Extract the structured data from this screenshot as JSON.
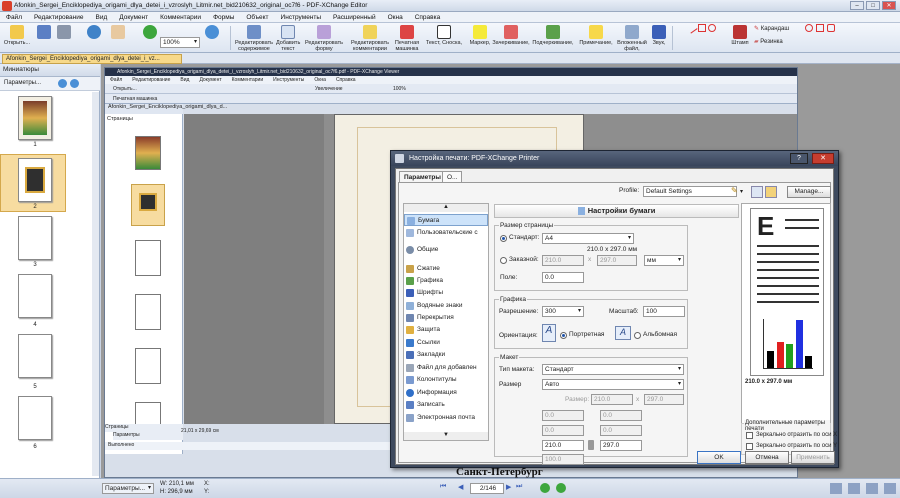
{
  "window": {
    "title": "Afonkin_Sergei_Enciklopediya_origami_dlya_detei_i_vzroslyh_Litmir.net_bid210632_original_oc7f6 - PDF-XChange Editor",
    "min": "–",
    "max": "□",
    "close": "✕"
  },
  "menu": [
    "Файл",
    "Редактирование",
    "Вид",
    "Документ",
    "Комментарии",
    "Формы",
    "Объект",
    "Инструменты",
    "Расширенный",
    "Окна",
    "Справка"
  ],
  "ribbon": {
    "open": "Открыть...",
    "zoom": "100%",
    "edit_content": "Редактировать содержимое",
    "add_text": "Добавить текст",
    "edit_form": "Редактировать форму",
    "edit_comments": "Редактировать комментарии",
    "typewriter": "Печатная машинка",
    "text_callout": "Текст, Сноска,",
    "marker": "Маркер,",
    "strikeout": "Зачеркивание,",
    "underline": "Подчеркивание,",
    "note": "Примечание,",
    "attached_file": "Вложенный файл,",
    "sound": "Звук,",
    "stamp": "Штамп",
    "pencil": "Карандаш",
    "eraser": "Резинка"
  },
  "doc_tab": "Afonkin_Sergei_Enciklopediya_origami_dlya_detei_i_vz...",
  "sidebar": {
    "title": "Миниатюры",
    "options": "Параметры...",
    "pages": [
      "1",
      "2",
      "3",
      "4",
      "5",
      "6"
    ]
  },
  "inner": {
    "title": "Afonkin_Sergei_Enciklopediya_origami_dlya_detei_i_vzroslyh_Litmir.net_bid210632_original_oc7f6.pdf - PDF-XChange Viewer",
    "menu": [
      "Файл",
      "Редактирование",
      "Вид",
      "Документ",
      "Комментарии",
      "Инструменты",
      "Окна",
      "Справка"
    ],
    "open": "Открыть...",
    "typewriter": "Печатная машинка",
    "enlarge": "Увеличение",
    "zoom": "100%",
    "side_title": "Страницы",
    "tab": "Afonkin_Sergei_Enciklopediya_origami_dlya_d...",
    "side_footer": "Страницы",
    "side_options": "Параметры",
    "size_info": "21,01 x 29,69 см",
    "status": "Выполнено",
    "footer_text": "Санкт-Петербург"
  },
  "statusbar": {
    "options": "Параметры...",
    "w": "W: 210,1 мм",
    "h": "H: 296,9 мм",
    "x": "X:",
    "y": "Y:",
    "page": "2/146"
  },
  "dialog": {
    "title": "Настройка печати: PDF-XChange Printer",
    "tabs": [
      "Параметры",
      "О..."
    ],
    "profile_label": "Profile:",
    "profile_value": "Default Settings",
    "manage": "Manage...",
    "section_title": "Настройки бумаги",
    "nav": [
      "Бумага",
      "Пользовательские с",
      "Общие",
      "Сжатие",
      "Графика",
      "Шрифты",
      "Водяные знаки",
      "Перекрытия",
      "Защита",
      "Ссылки",
      "Закладки",
      "Файл для добавлен",
      "Колонтитулы",
      "Информация",
      "Записать",
      "Электронная почта"
    ],
    "paper_size": {
      "title": "Размер страницы",
      "standard_label": "Стандарт:",
      "standard_value": "A4",
      "dims": "210.0 x 297.0 мм",
      "custom_label": "Заказной:",
      "custom_w": "210.0",
      "custom_h": "297.0",
      "x": "x",
      "unit": "мм",
      "margin_label": "Поле:",
      "margin_value": "0.0"
    },
    "graphics": {
      "title": "Графика",
      "resolution_label": "Разрешение:",
      "resolution_value": "300",
      "scale_label": "Масштаб:",
      "scale_value": "100",
      "orientation_label": "Ориентация:",
      "portrait": "Портретная",
      "landscape": "Альбомная"
    },
    "layout": {
      "title": "Макет",
      "type_label": "Тип макета:",
      "type_value": "Стандарт",
      "size_label": "Размер",
      "size_value": "Авто",
      "size_sub_label": "Размер:",
      "w1": "210.0",
      "h1": "297.0",
      "a1": "0.0",
      "b1": "0.0",
      "a2": "0.0",
      "b2": "0.0",
      "c1": "210.0",
      "c2": "297.0",
      "d1": "100.0"
    },
    "preview": {
      "dims": "210.0 x 297.0 мм",
      "letter": "E",
      "bars": [
        {
          "value": 0.35,
          "color": "#000000"
        },
        {
          "value": 0.55,
          "color": "#e02020"
        },
        {
          "value": 0.5,
          "color": "#20a020"
        },
        {
          "value": 1.0,
          "color": "#2030e0"
        },
        {
          "value": 0.25,
          "color": "#000000"
        }
      ]
    },
    "extra": {
      "title": "Дополнительные параметры печати",
      "mirror_x": "Зеркально отразить по оси X",
      "mirror_y": "Зеркально отразить по оси Y"
    },
    "ok": "OK",
    "cancel": "Отмена",
    "apply": "Применить"
  }
}
